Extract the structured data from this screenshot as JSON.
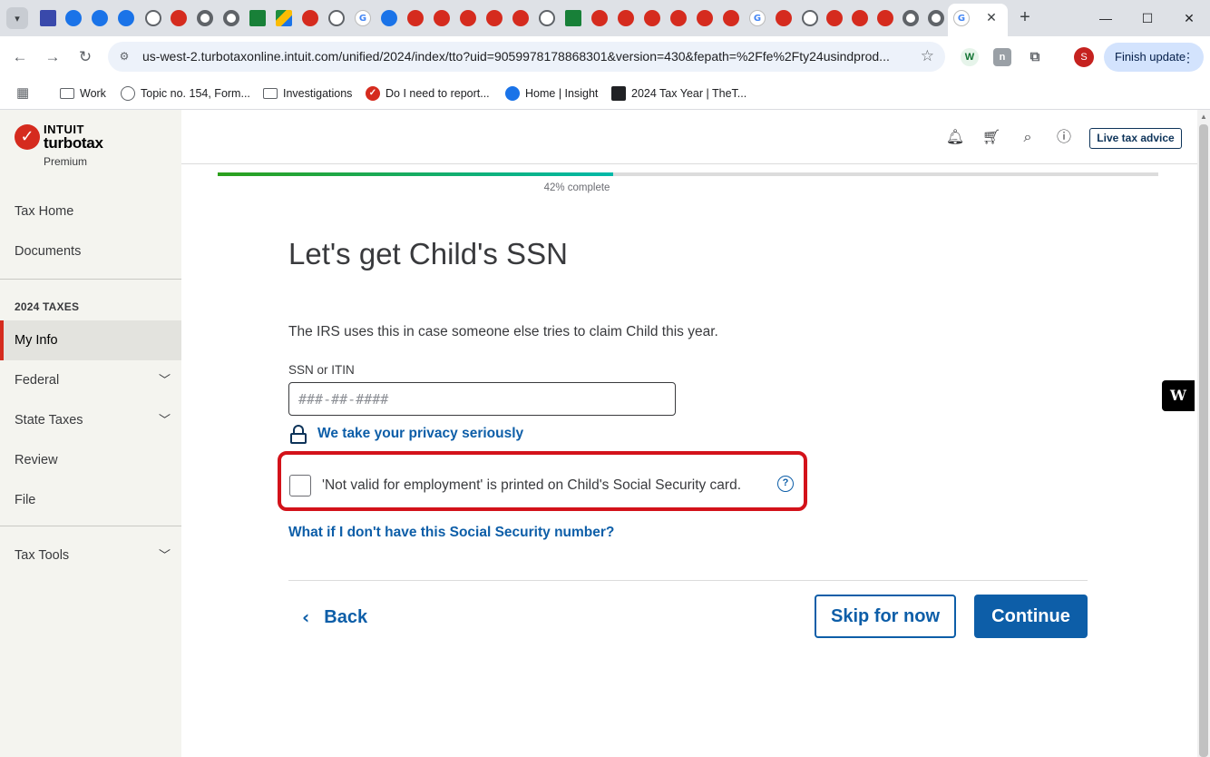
{
  "browser": {
    "url": "us-west-2.turbotaxonline.intuit.com/unified/2024/index/tto?uid=9059978178868301&version=430&fepath=%2Ffe%2Fty24usindprod...",
    "finish_update": "Finish update",
    "profile_initial": "S",
    "ext_w": "W",
    "ext_n": "n",
    "bookmarks": [
      {
        "label": "Work"
      },
      {
        "label": "Topic no. 154, Form..."
      },
      {
        "label": "Investigations"
      },
      {
        "label": "Do I need to report..."
      },
      {
        "label": "Home | Insight"
      },
      {
        "label": "2024 Tax Year | TheT..."
      }
    ],
    "tab_glyph_google": "G"
  },
  "brand": {
    "company": "INTUIT",
    "product": "turbotax",
    "tier": "Premium",
    "check_glyph": "✓"
  },
  "sidebar": {
    "top_items": [
      {
        "label": "Tax Home"
      },
      {
        "label": "Documents"
      }
    ],
    "section_heading": "2024 TAXES",
    "section_items": [
      {
        "label": "My Info",
        "active": true
      },
      {
        "label": "Federal"
      },
      {
        "label": "State Taxes"
      },
      {
        "label": "Review"
      },
      {
        "label": "File"
      }
    ],
    "tools_label": "Tax Tools"
  },
  "topbar": {
    "live_advice": "Live tax advice"
  },
  "progress": {
    "percent": 42,
    "label": "42% complete"
  },
  "main": {
    "heading": "Let's get Child's SSN",
    "intro": "The IRS uses this in case someone else tries to claim Child this year.",
    "field_label": "SSN or ITIN",
    "field_placeholder": "###-##-####",
    "privacy_link": "We take your privacy seriously",
    "checkbox_label": "'Not valid for employment' is printed on Child's Social Security card.",
    "help_glyph": "?",
    "no_ssn_link": "What if I don't have this Social Security number?"
  },
  "buttons": {
    "back": "Back",
    "skip": "Skip for now",
    "continue": "Continue"
  },
  "colors": {
    "accent": "#0d5ea8",
    "highlight": "#d3121a",
    "brand_red": "#d52b1e",
    "sidebar_bg": "#f4f4ef"
  },
  "widget_glyph": "W"
}
